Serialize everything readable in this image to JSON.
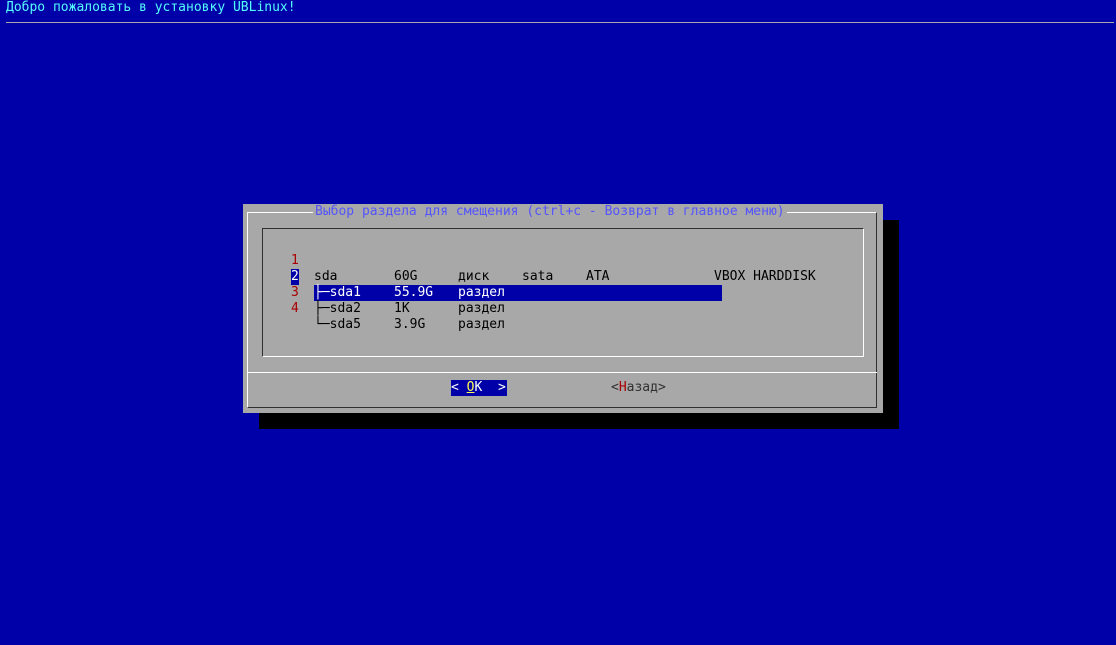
{
  "backtitle": "Добро пожаловать в установку UBLinux!",
  "dialog": {
    "title": "Выбор раздела для смещения (ctrl+c - Возврат в главное меню)",
    "rows": [
      {
        "tag": "1",
        "device": "sda",
        "size": "60G",
        "kind": "диск",
        "transport": "sata",
        "vendor": "ATA",
        "model": "VBOX HARDDISK"
      },
      {
        "tag": "2",
        "device": "├─sda1",
        "size": "55.9G",
        "kind": "раздел",
        "transport": "",
        "vendor": "",
        "model": ""
      },
      {
        "tag": "3",
        "device": "├─sda2",
        "size": "1K",
        "kind": "раздел",
        "transport": "",
        "vendor": "",
        "model": ""
      },
      {
        "tag": "4",
        "device": "└─sda5",
        "size": "3.9G",
        "kind": "раздел",
        "transport": "",
        "vendor": "",
        "model": ""
      }
    ],
    "selected_index": 1,
    "ok_button": {
      "open": "< ",
      "hot": "O",
      "rest": "K",
      "close": "  >"
    },
    "back_button": {
      "open": "<",
      "hot": "Н",
      "rest": "азад",
      "close": ">"
    }
  }
}
